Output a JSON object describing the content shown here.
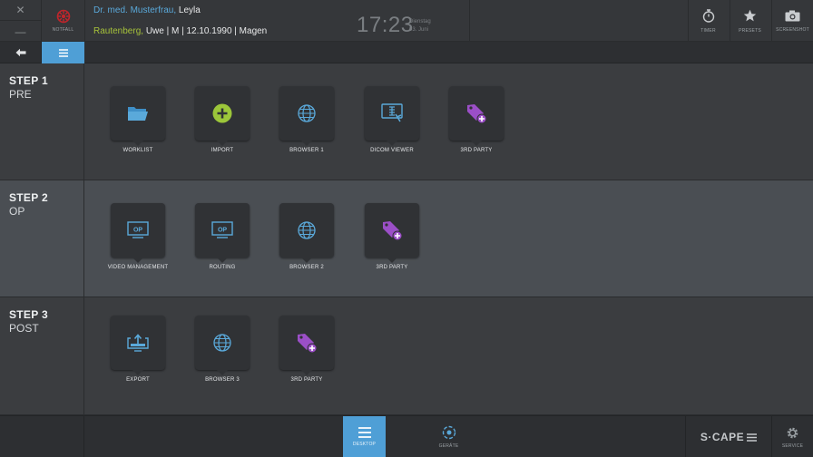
{
  "window": {
    "close_glyph": "✕",
    "minimize_glyph": "—"
  },
  "emergency": {
    "label": "NOTFALL",
    "icon": "emergency-icon",
    "color": "#c0252b"
  },
  "patient_header": {
    "doctor_name": "Dr. med. Musterfrau,",
    "doctor_first": " Leyla",
    "patient_last": "Rautenberg,",
    "patient_details": " Uwe | M | 12.10.1990 | Magen"
  },
  "clock": {
    "time": "17:23",
    "weekday": "Dienstag",
    "date": "03. Juni"
  },
  "tools": [
    {
      "label": "TIMER",
      "icon": "stopwatch-icon"
    },
    {
      "label": "PRESETS",
      "icon": "star-icon"
    },
    {
      "label": "SCREENSHOT",
      "icon": "camera-icon"
    }
  ],
  "nav": {
    "back_icon": "arrow-left-icon",
    "menu_icon": "menu-icon"
  },
  "steps": [
    {
      "title": "STEP 1",
      "subtitle": "PRE",
      "apps": [
        {
          "label": "WORKLIST",
          "icon": "folder-icon"
        },
        {
          "label": "IMPORT",
          "icon": "plus-circle-icon"
        },
        {
          "label": "BROWSER 1",
          "icon": "globe-icon"
        },
        {
          "label": "DICOM VIEWER",
          "icon": "dicom-viewer-icon"
        },
        {
          "label": "3RD PARTY",
          "icon": "tag-plus-icon"
        }
      ]
    },
    {
      "title": "STEP 2",
      "subtitle": "OP",
      "apps": [
        {
          "label": "VIDEO MANAGEMENT",
          "icon": "op-monitor-icon",
          "badge": "OP"
        },
        {
          "label": "ROUTING",
          "icon": "op-monitor-icon",
          "badge": "OP"
        },
        {
          "label": "BROWSER 2",
          "icon": "globe-icon"
        },
        {
          "label": "3RD PARTY",
          "icon": "tag-plus-icon"
        }
      ]
    },
    {
      "title": "STEP 3",
      "subtitle": "POST",
      "apps": [
        {
          "label": "EXPORT",
          "icon": "export-icon"
        },
        {
          "label": "BROWSER 3",
          "icon": "globe-icon"
        },
        {
          "label": "3RD PARTY",
          "icon": "tag-plus-icon"
        }
      ]
    }
  ],
  "bottom": {
    "desktop_label": "DESKTOP",
    "devices_label": "GERÄTE",
    "brand": "S·CAPE",
    "service_label": "SERVICE"
  },
  "colors": {
    "accent": "#4f9fd6",
    "doctor": "#5aa9da",
    "patient": "#a6c23a",
    "third_party": "#9b4fc7",
    "import": "#9cc63a"
  }
}
